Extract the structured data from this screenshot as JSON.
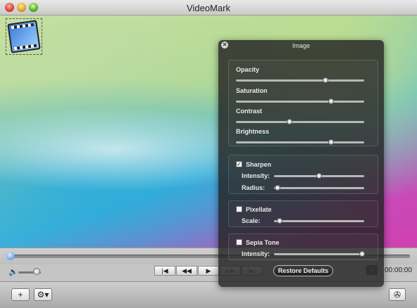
{
  "window": {
    "title": "VideoMark"
  },
  "player": {
    "time": "00:00:00",
    "seek_value": 0,
    "volume": 0.8,
    "transport": [
      "|◀",
      "◀◀",
      "▶",
      "▶▶",
      "▶|"
    ]
  },
  "bottombar": {
    "add_label": "+",
    "gear_label": "⚙▾"
  },
  "image_panel": {
    "title": "Image",
    "sliders": [
      {
        "label": "Opacity",
        "value": 0.7
      },
      {
        "label": "Saturation",
        "value": 0.74
      },
      {
        "label": "Contrast",
        "value": 0.42
      },
      {
        "label": "Brightness",
        "value": 0.74
      }
    ],
    "sharpen": {
      "label": "Sharpen",
      "checked": true,
      "intensity_label": "Intensity:",
      "intensity": 0.5,
      "radius_label": "Radius:",
      "radius": 0.04
    },
    "pixellate": {
      "label": "Pixellate",
      "checked": false,
      "scale_label": "Scale:",
      "scale": 0.06
    },
    "sepia": {
      "label": "Sepia Tone",
      "checked": false,
      "intensity_label": "Intensity:",
      "intensity": 0.98
    },
    "restore_label": "Restore Defaults",
    "info_label": "i"
  }
}
